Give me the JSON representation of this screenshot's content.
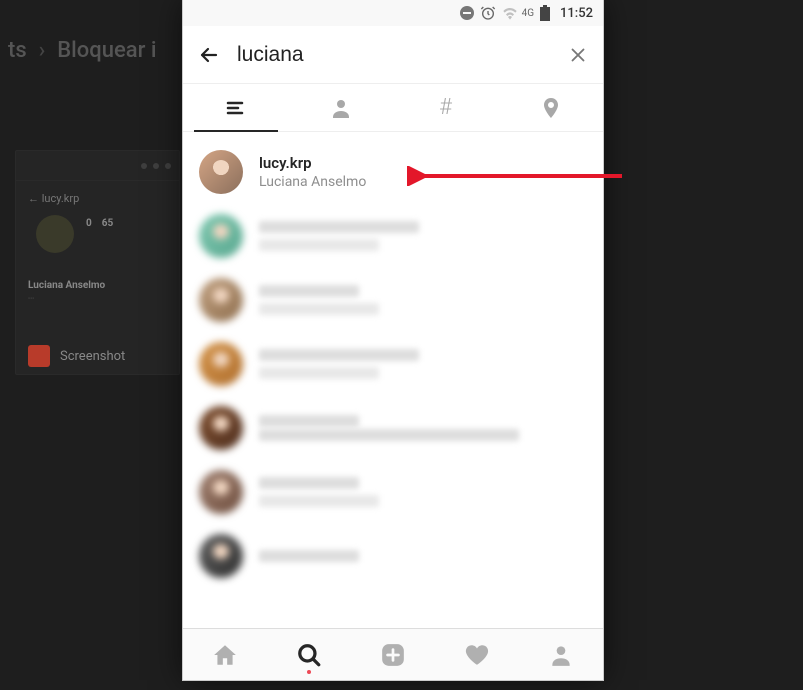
{
  "background": {
    "breadcrumb_partial_left": "ts",
    "breadcrumb_current": "Bloquear i",
    "card_username": "lucy.krp",
    "card_fullname": "Luciana Anselmo",
    "screenshot_label": "Screenshot",
    "stats": {
      "posts": "0",
      "followers": "65"
    }
  },
  "status": {
    "network": "4G",
    "time": "11:52"
  },
  "search": {
    "query": "luciana"
  },
  "tabs": {
    "active_index": 0
  },
  "results": [
    {
      "username": "lucy.krp",
      "fullname": "Luciana Anselmo",
      "blurred": false
    }
  ],
  "blurred_results_count": 6
}
